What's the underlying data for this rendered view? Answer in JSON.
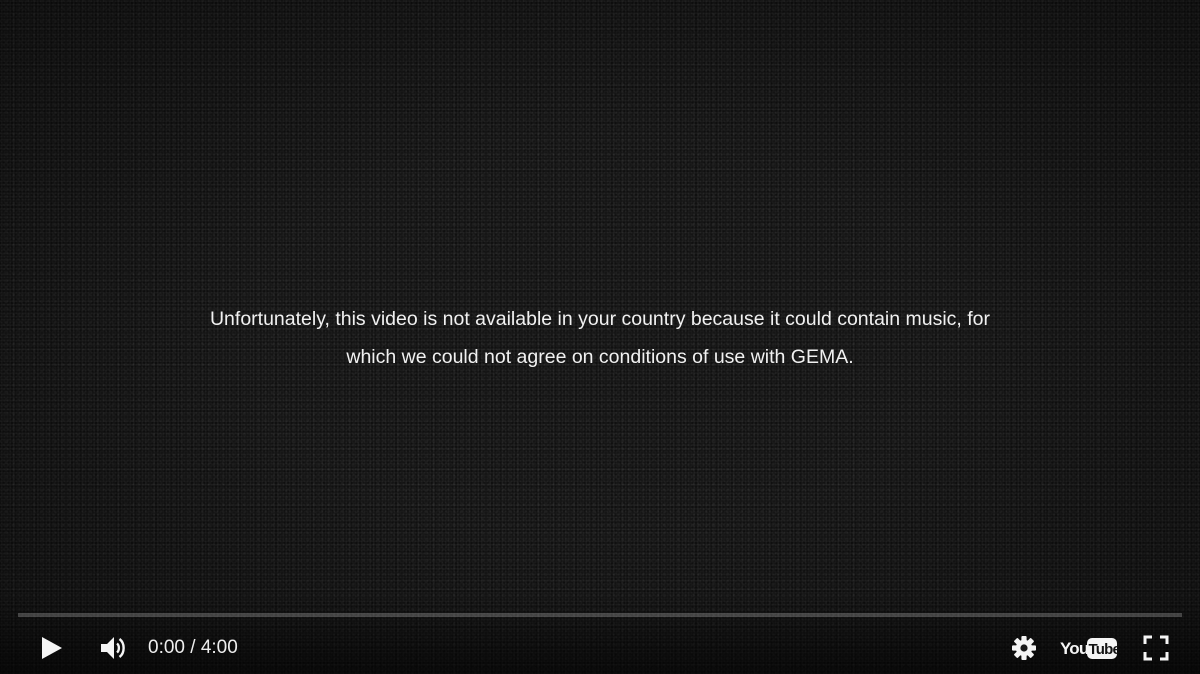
{
  "message": {
    "line1": "Unfortunately, this video is not available in your country because it could contain music, for",
    "line2": "which we could not agree on conditions of use with GEMA."
  },
  "player": {
    "progress_fraction": 0,
    "time": {
      "current": "0:00",
      "separator": " / ",
      "duration": "4:00"
    },
    "logo_text": {
      "you": "You",
      "tube": "Tube"
    }
  },
  "icons": {
    "play": "play-icon",
    "volume": "volume-icon",
    "settings": "gear-icon",
    "logo": "youtube-logo-icon",
    "fullscreen": "fullscreen-icon"
  },
  "colors": {
    "background": "#141414",
    "text": "#f1f1f1",
    "progress_played": "#ff0000",
    "progress_track": "rgba(255,255,255,0.22)"
  }
}
